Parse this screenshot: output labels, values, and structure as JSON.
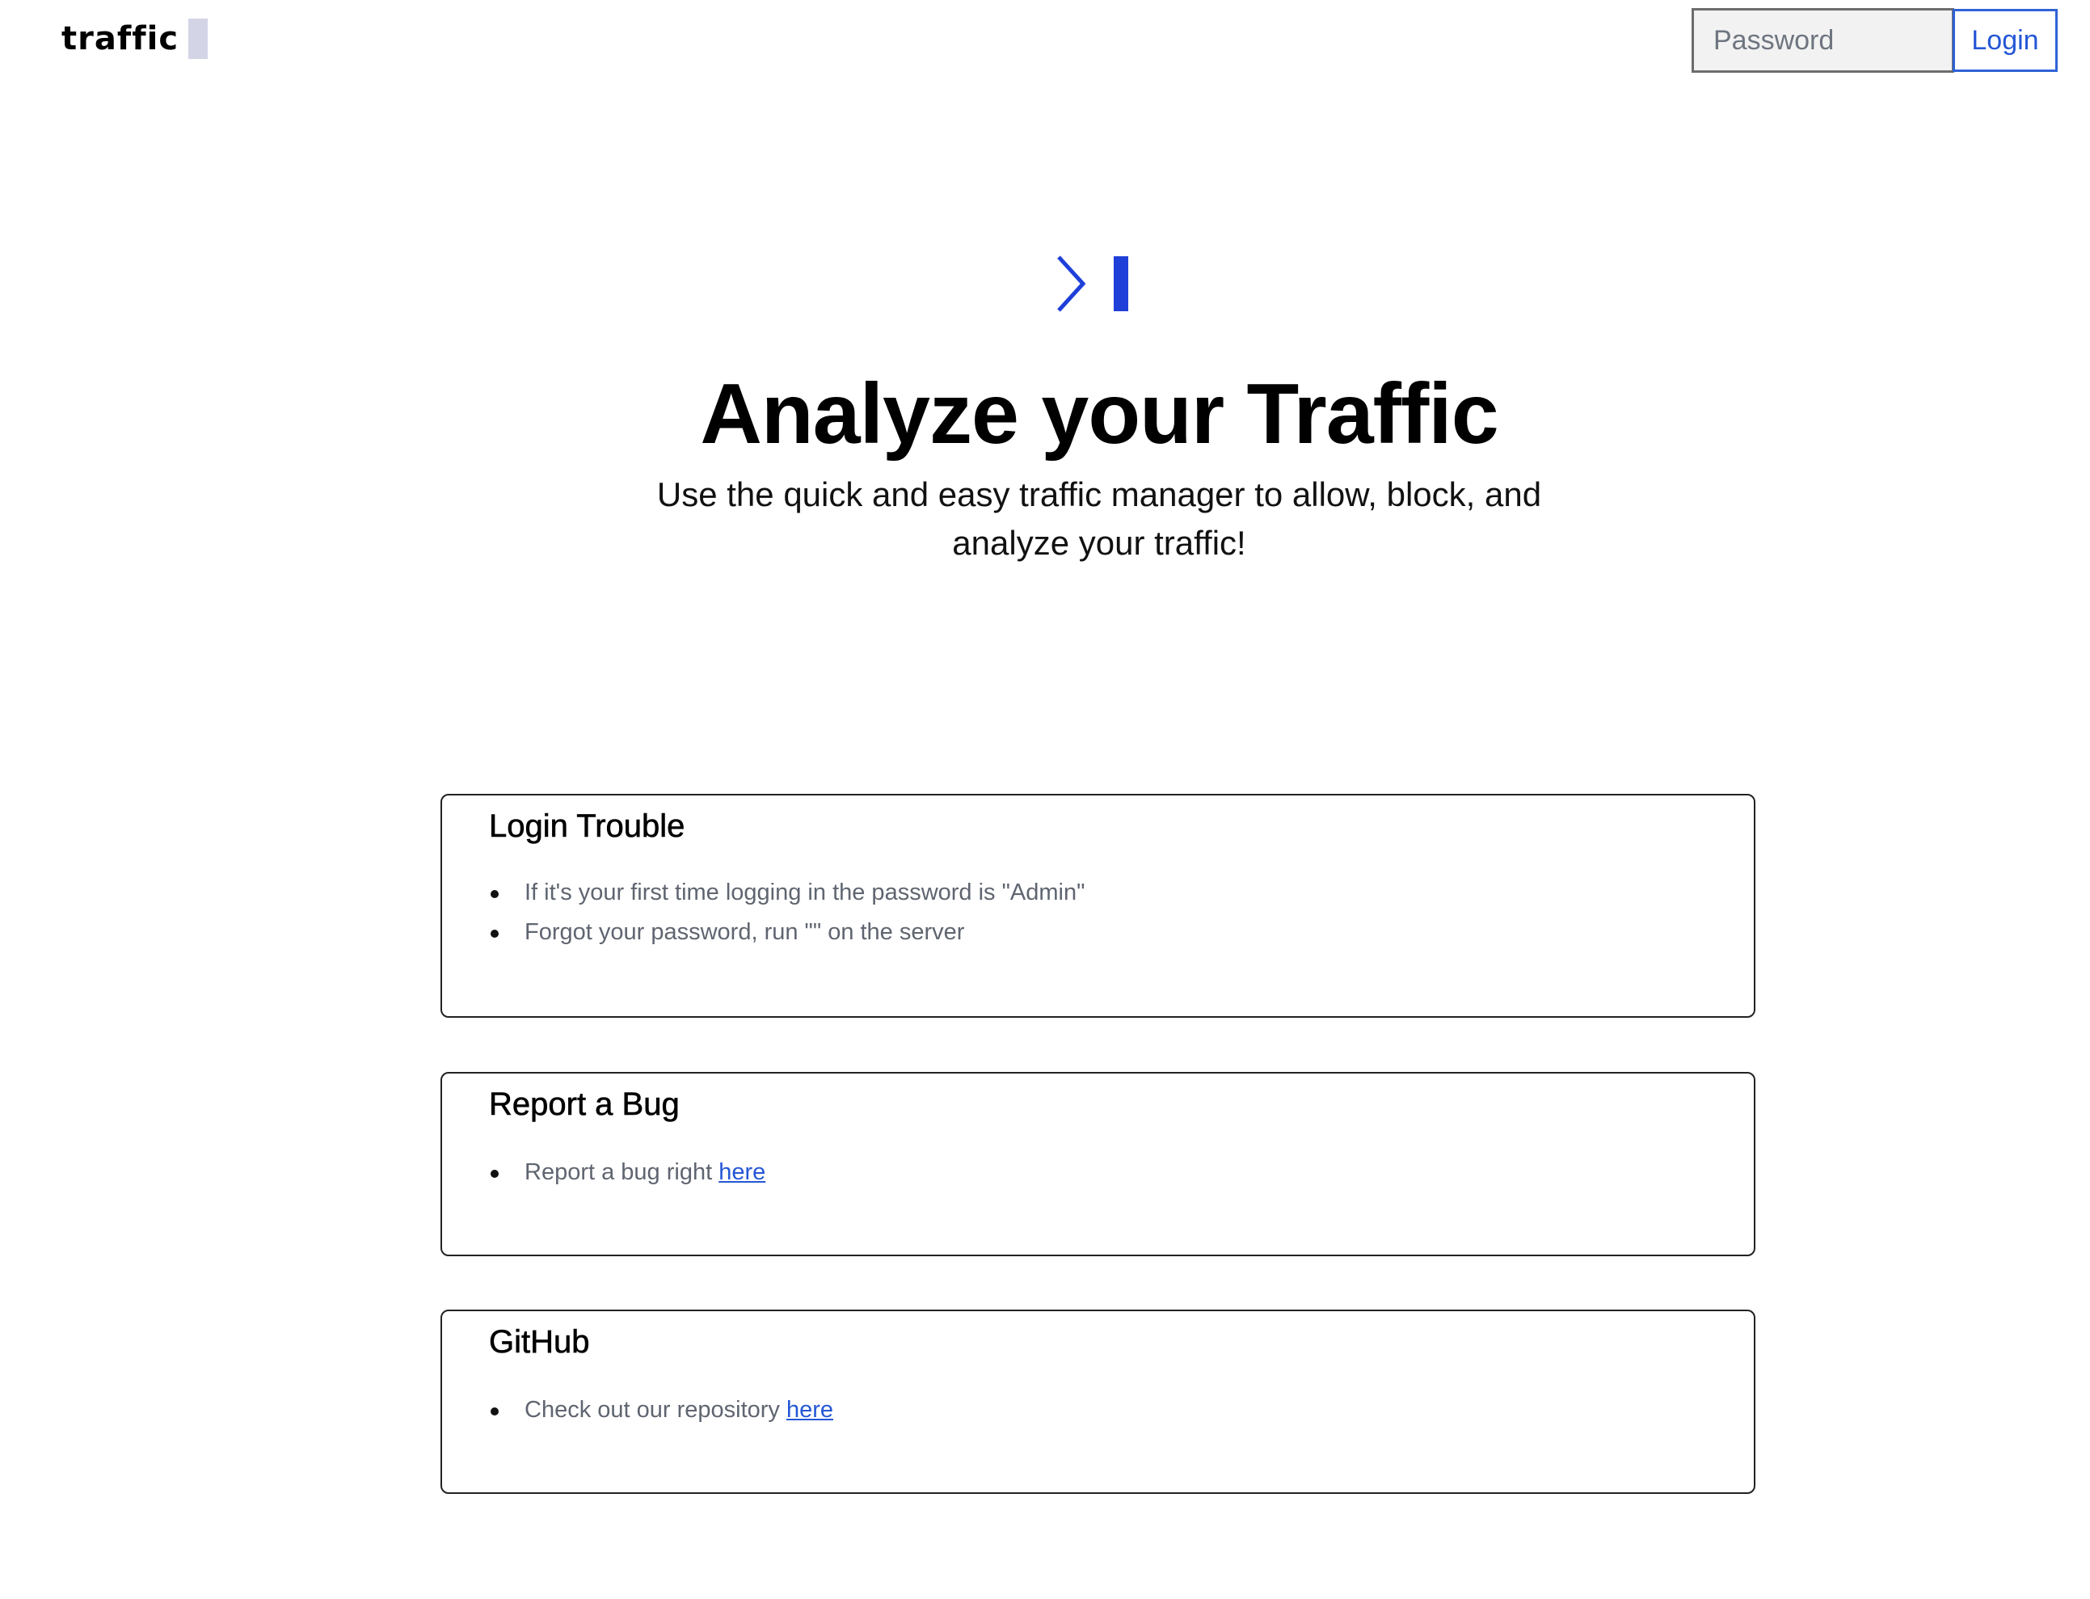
{
  "header": {
    "logo_text": "traffic",
    "password_placeholder": "Password",
    "login_label": "Login"
  },
  "hero": {
    "icon": "terminal-prompt-icon",
    "title": "Analyze your Traffic",
    "subtitle": "Use the quick and easy traffic manager to allow, block, and analyze your traffic!"
  },
  "cards": {
    "login_trouble": {
      "title": "Login Trouble",
      "items": [
        "If it's your first time logging in the password is \"Admin\"",
        "Forgot your password, run \"\" on the server"
      ]
    },
    "report_bug": {
      "title": "Report a Bug",
      "item_text": "Report a bug right ",
      "link_text": "here"
    },
    "github": {
      "title": "GitHub",
      "item_text": "Check out our repository ",
      "link_text": "here"
    }
  },
  "colors": {
    "accent": "#1f3fd9",
    "link": "#2457d6",
    "logo_cursor": "#d3d4e6",
    "muted_text": "#5f6570"
  }
}
